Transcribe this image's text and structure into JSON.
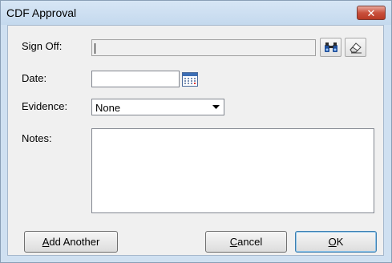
{
  "window": {
    "title": "CDF Approval",
    "close_label": "✕"
  },
  "form": {
    "sign_off_label": "Sign Off:",
    "sign_off_value": "",
    "date_label": "Date:",
    "date_value": "",
    "evidence_label": "Evidence:",
    "evidence_value": "None",
    "notes_label": "Notes:",
    "notes_value": ""
  },
  "buttons": {
    "add_another_mnemonic": "A",
    "add_another_rest": "dd Another",
    "cancel_mnemonic": "C",
    "cancel_rest": "ancel",
    "ok_mnemonic": "O",
    "ok_rest": "K"
  },
  "icons": {
    "lookup": "binoculars-icon",
    "clear": "eraser-icon",
    "calendar": "calendar-icon",
    "dropdown": "chevron-down-icon"
  },
  "colors": {
    "close_button": "#c9503c",
    "title_bar": "#c4d9ee",
    "client_bg": "#f0f0f0"
  }
}
